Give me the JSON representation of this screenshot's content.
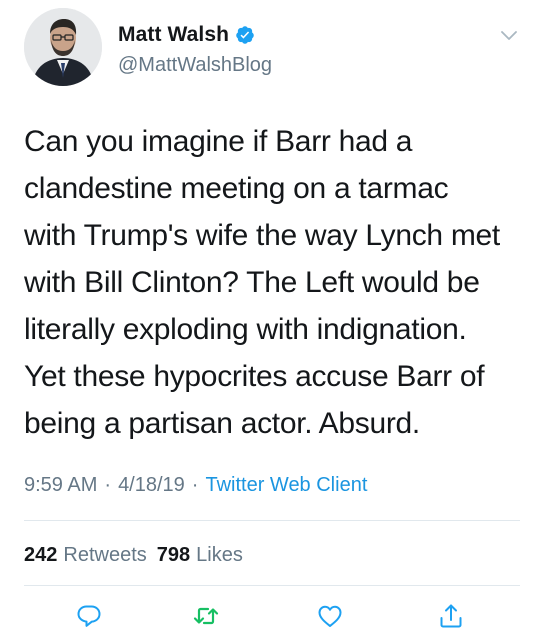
{
  "tweet": {
    "author": {
      "display_name": "Matt Walsh",
      "handle": "@MattWalshBlog",
      "verified": true
    },
    "text": "Can you imagine if Barr had a clandestine meeting on a tarmac with Trump's wife the way Lynch met with Bill Clinton? The Left would be literally exploding with indignation. Yet these hypocrites accuse Barr of being a partisan actor. Absurd.",
    "text_lines": [
      "Can you imagine if Barr had a",
      "clandestine meeting on a tarmac",
      "with Trump's wife the way Lynch met",
      "with Bill Clinton? The Left would be",
      "literally exploding with indignation.",
      "Yet these hypocrites accuse Barr of",
      "being a partisan actor. Absurd."
    ],
    "time": "9:59 AM",
    "date": "4/18/19",
    "separator": "·",
    "client": "Twitter Web Client",
    "retweets_count": "242",
    "retweets_label": "Retweets",
    "likes_count": "798",
    "likes_label": "Likes"
  },
  "icons": {
    "verified": "verified-badge-icon",
    "menu": "chevron-down-icon",
    "reply": "reply-icon",
    "retweet": "retweet-icon",
    "like": "heart-icon",
    "share": "share-icon"
  },
  "colors": {
    "text": "#14171a",
    "secondary": "#657786",
    "link": "#1b95e0",
    "verified": "#1da1f2",
    "retweet": "#17bf63",
    "action": "#1da1f2",
    "divider": "#e1e8ed"
  }
}
